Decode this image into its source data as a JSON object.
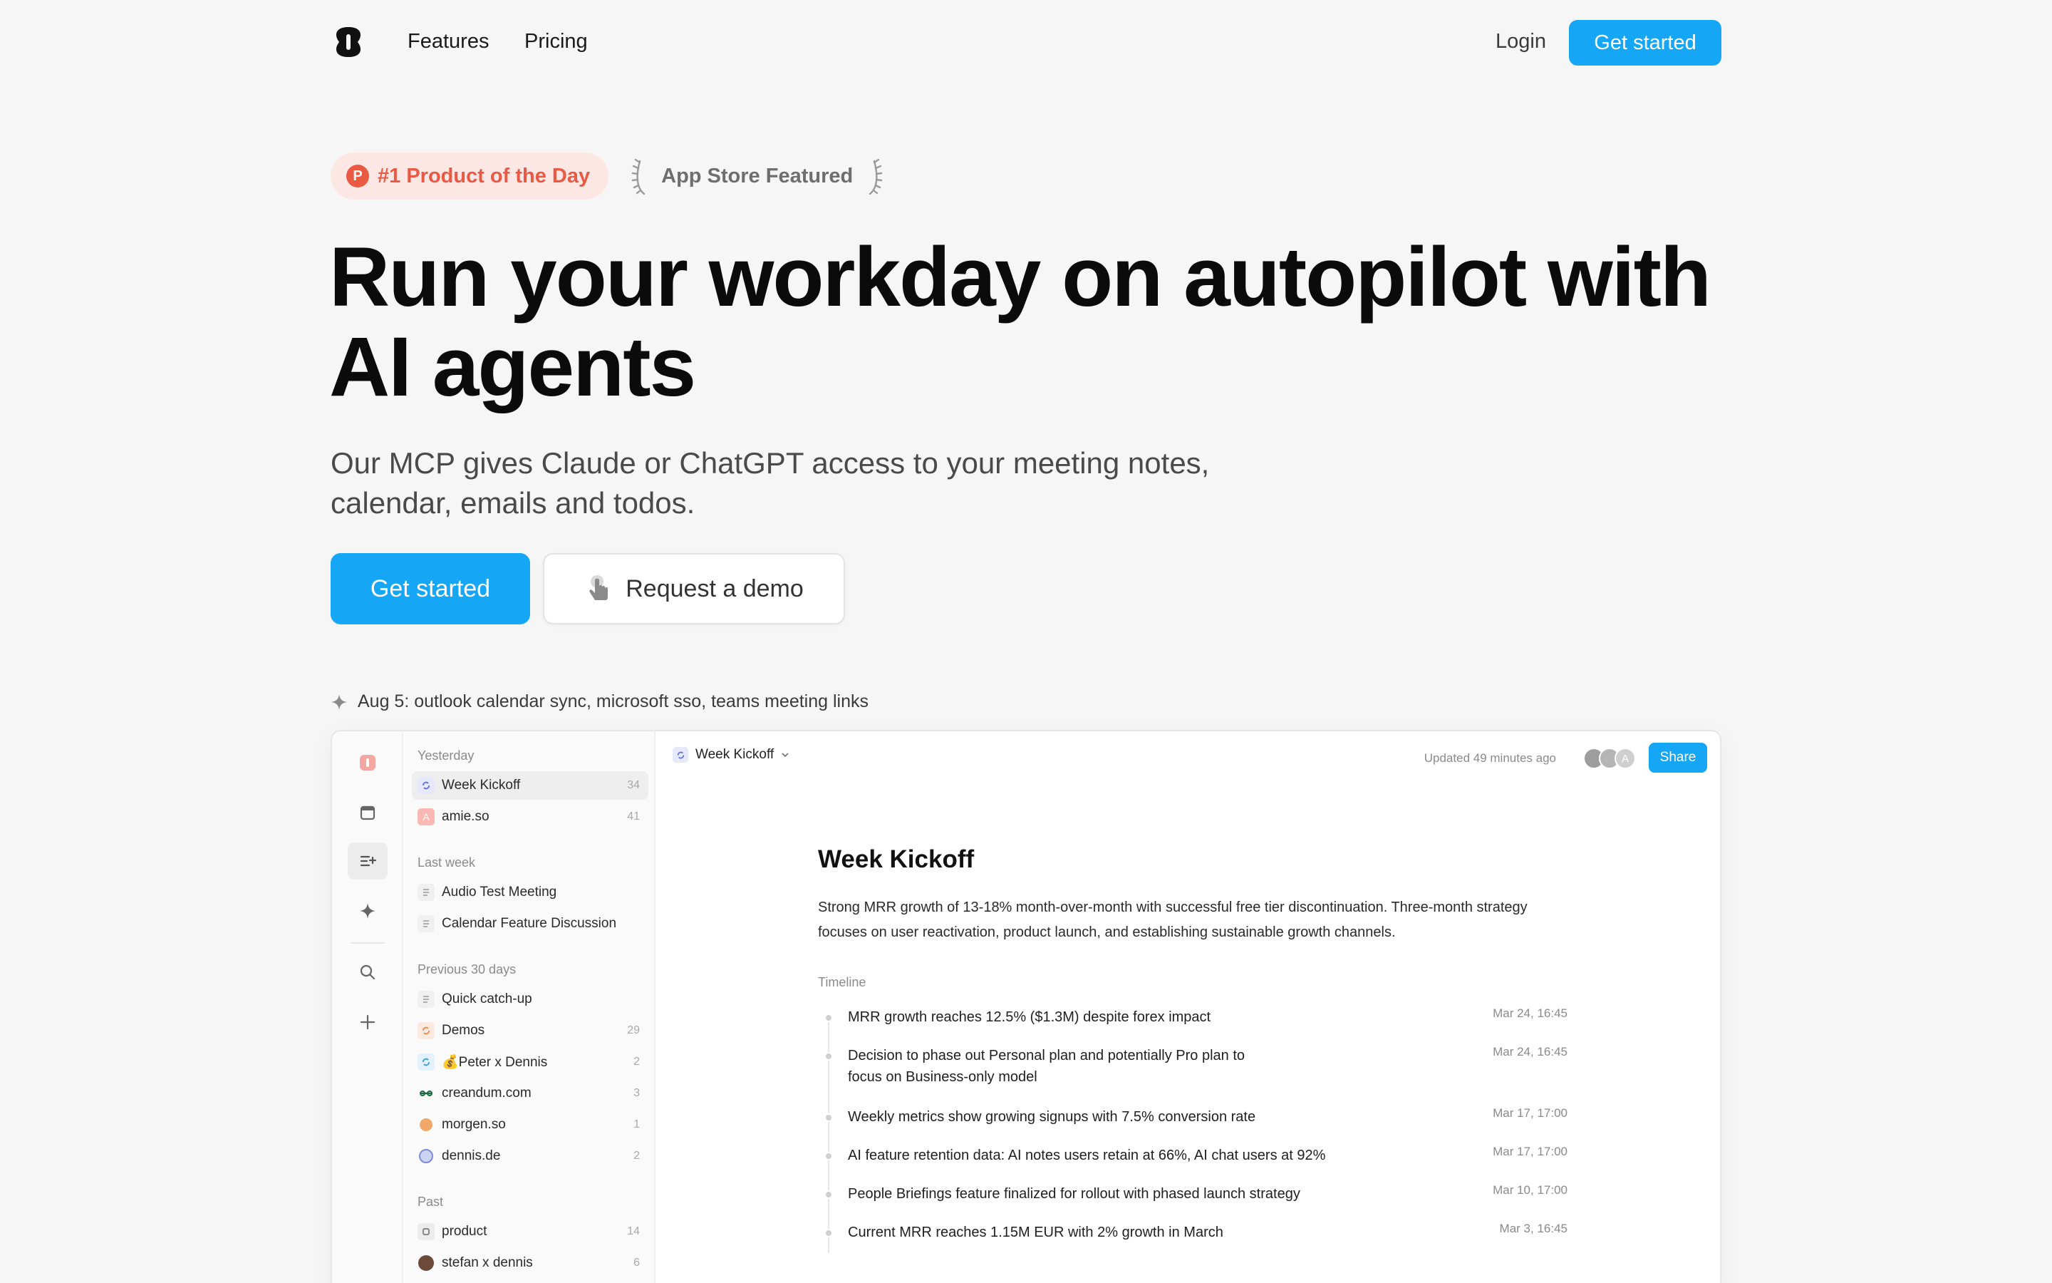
{
  "nav": {
    "features": "Features",
    "pricing": "Pricing",
    "login": "Login",
    "cta": "Get started"
  },
  "badges": {
    "product_hunt_letter": "P",
    "product_hunt": "#1 Product of the Day",
    "app_store": "App Store Featured"
  },
  "hero": {
    "headline_line1": "Run your workday on autopilot with",
    "headline_line2": "AI agents",
    "subhead": "Our MCP gives Claude or ChatGPT access to your meeting notes, calendar, emails and todos.",
    "cta_primary": "Get started",
    "cta_secondary": "Request a demo"
  },
  "changelog": "Aug 5: outlook calendar sync, microsoft sso, teams meeting links",
  "colors": {
    "accent": "#15a6f5",
    "ph_bg": "#fde7e4",
    "ph_text": "#e85a44"
  },
  "app": {
    "groups": {
      "yesterday": "Yesterday",
      "last_week": "Last week",
      "prev30": "Previous 30 days",
      "past": "Past"
    },
    "items": [
      {
        "title": "Week Kickoff",
        "count": "34",
        "icon": "sync-icon"
      },
      {
        "title": "amie.so",
        "count": "41",
        "icon": "amie-icon"
      },
      {
        "title": "Audio Test Meeting",
        "count": "",
        "icon": "doc-icon"
      },
      {
        "title": "Calendar Feature Discussion",
        "count": "",
        "icon": "doc-icon"
      },
      {
        "title": "Quick catch-up",
        "count": "",
        "icon": "doc-icon"
      },
      {
        "title": "Demos",
        "count": "29",
        "icon": "sync-icon"
      },
      {
        "title": "💰Peter x Dennis",
        "count": "2",
        "icon": "sync-icon"
      },
      {
        "title": "creandum.com",
        "count": "3",
        "icon": "link-icon"
      },
      {
        "title": "morgen.so",
        "count": "1",
        "icon": "dot-icon"
      },
      {
        "title": "dennis.de",
        "count": "2",
        "icon": "globe-icon"
      },
      {
        "title": "product",
        "count": "14",
        "icon": "square-icon"
      },
      {
        "title": "stefan x dennis",
        "count": "6",
        "icon": "avatar-icon"
      }
    ],
    "doc": {
      "crumb": "Week Kickoff",
      "updated": "Updated 49 minutes ago",
      "avatar_letter": "A",
      "share": "Share",
      "title": "Week Kickoff",
      "summary": "Strong MRR growth of 13-18% month-over-month with successful free tier discontinuation. Three-month strategy focuses on user reactivation, product launch, and establishing sustainable growth channels.",
      "timeline_label": "Timeline",
      "timeline": [
        {
          "text": "MRR growth reaches 12.5% ($1.3M) despite forex impact",
          "date": "Mar 24, 16:45"
        },
        {
          "text": "Decision to phase out Personal plan and potentially Pro plan to focus on Business-only model",
          "date": "Mar 24, 16:45"
        },
        {
          "text": "Weekly metrics show growing signups with 7.5% conversion rate",
          "date": "Mar 17, 17:00"
        },
        {
          "text": "AI feature retention data: AI notes users retain at 66%, AI chat users at 92%",
          "date": "Mar 17, 17:00"
        },
        {
          "text": "People Briefings feature finalized for rollout with phased launch strategy",
          "date": "Mar 10, 17:00"
        },
        {
          "text": "Current MRR reaches 1.15M EUR with 2% growth in March",
          "date": "Mar 3, 16:45"
        }
      ]
    }
  }
}
